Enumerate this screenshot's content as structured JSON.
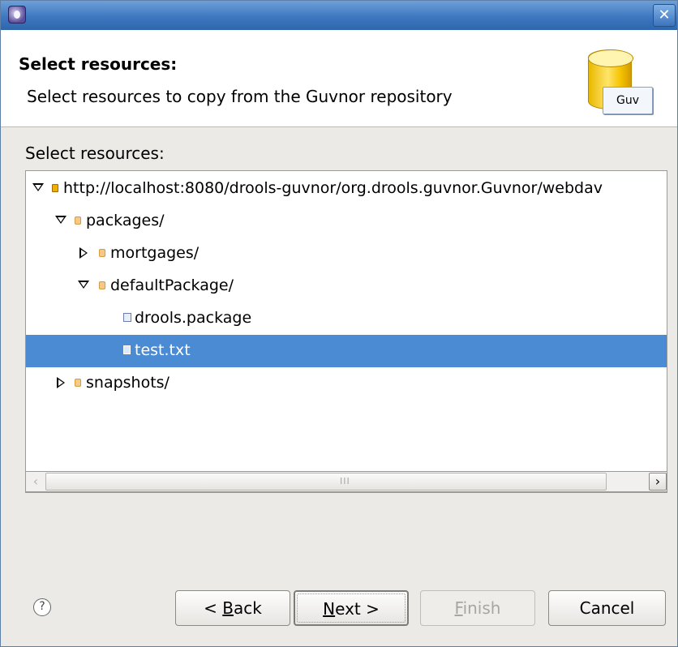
{
  "window": {
    "title": ""
  },
  "header": {
    "title": "Select resources:",
    "description": "Select resources to copy from the Guvnor repository",
    "icon_label": "Guv"
  },
  "section_label": "Select resources:",
  "tree": {
    "nodes": [
      {
        "label": "http://localhost:8080/drools-guvnor/org.drools.guvnor.Guvnor/webdav",
        "type": "server",
        "expanded": true,
        "selected": false
      },
      {
        "label": "packages/",
        "type": "folder",
        "expanded": true,
        "selected": false
      },
      {
        "label": "mortgages/",
        "type": "folder",
        "expanded": false,
        "selected": false
      },
      {
        "label": "defaultPackage/",
        "type": "folder",
        "expanded": true,
        "selected": false
      },
      {
        "label": "drools.package",
        "type": "package-file",
        "selected": false
      },
      {
        "label": "test.txt",
        "type": "file",
        "selected": true
      },
      {
        "label": "snapshots/",
        "type": "folder",
        "expanded": false,
        "selected": false
      }
    ],
    "selection_color": "#4a8bd4"
  },
  "scrollbar": {
    "grip": "III"
  },
  "buttons": {
    "help_glyph": "?",
    "back_pre": "< ",
    "back_mn": "B",
    "back_post": "ack",
    "next_mn": "N",
    "next_post": "ext >",
    "finish_mn": "F",
    "finish_post": "inish",
    "cancel": "Cancel"
  },
  "colors": {
    "titlebar": "#3f78c0",
    "dialog_bg": "#eceae7"
  }
}
